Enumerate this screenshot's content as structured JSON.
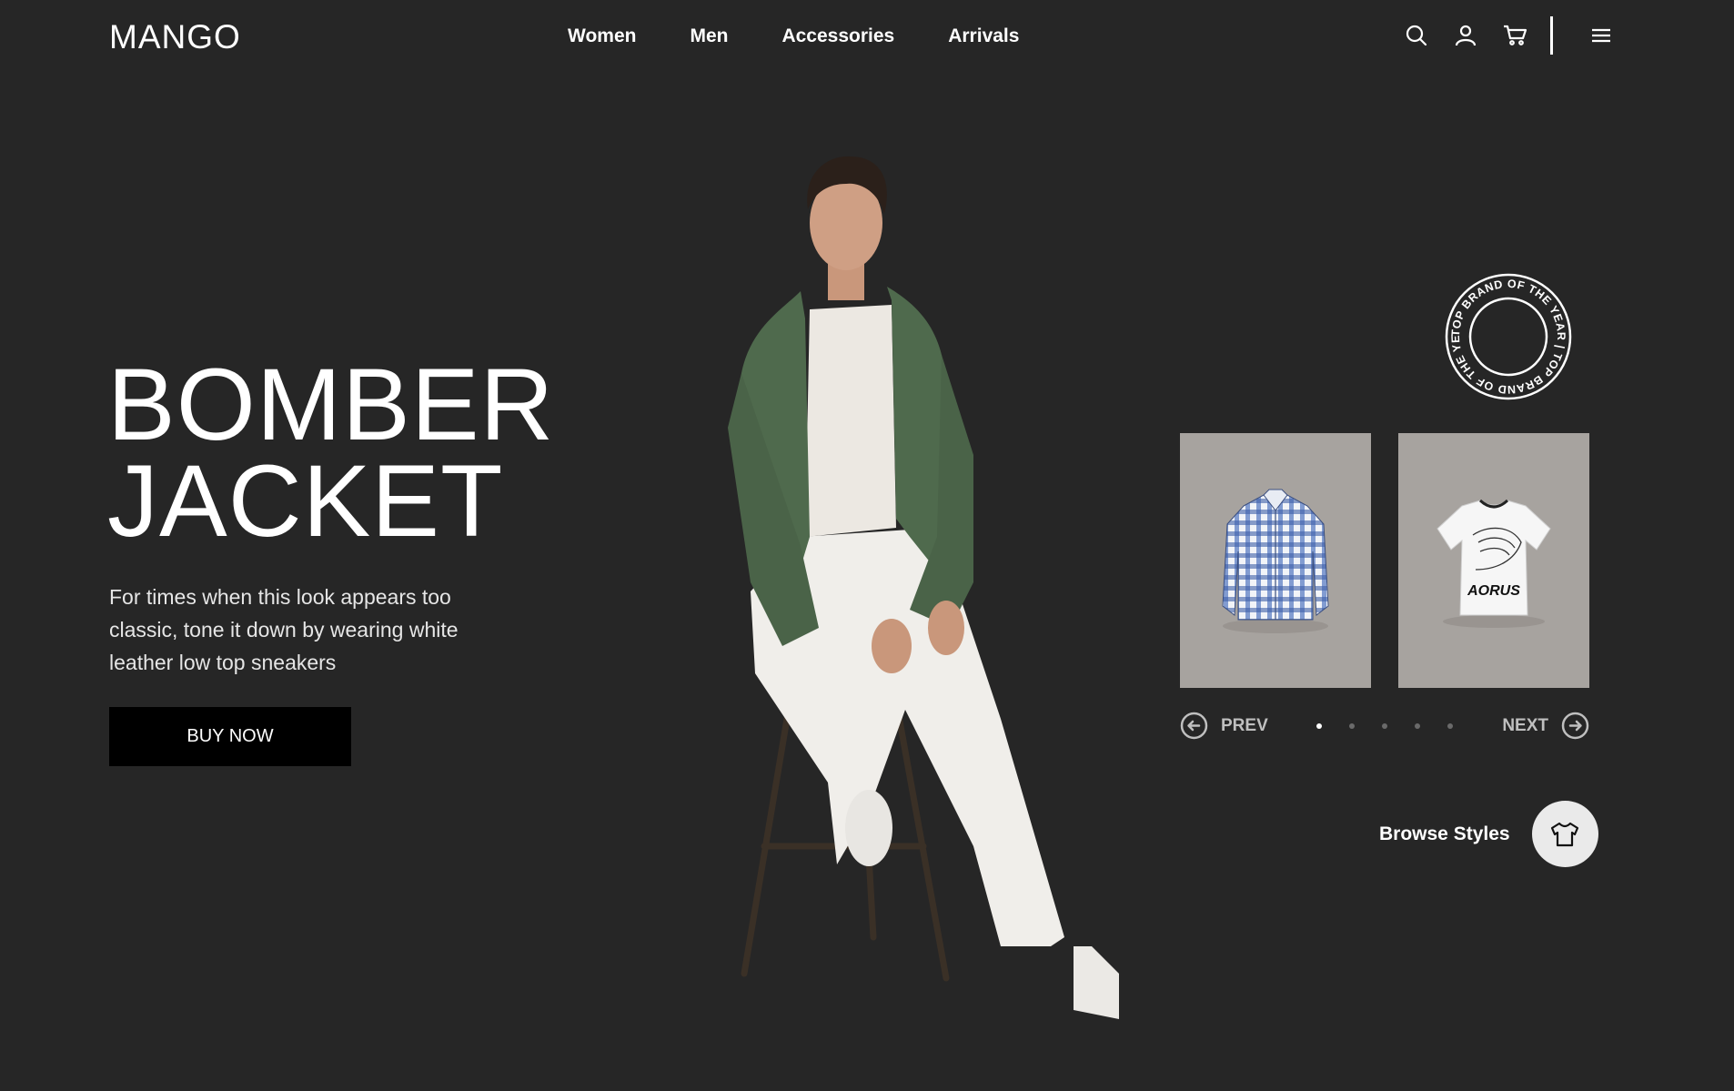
{
  "brand": {
    "logo": "MANGO"
  },
  "nav": {
    "items": [
      {
        "label": "Women"
      },
      {
        "label": "Men"
      },
      {
        "label": "Accessories"
      },
      {
        "label": "Arrivals"
      }
    ]
  },
  "header_icons": [
    "search-icon",
    "user-icon",
    "cart-icon",
    "menu-icon"
  ],
  "hero": {
    "title_line1": "BOMBER",
    "title_line2": "JACKET",
    "description": "For times when this look appears too classic, tone it down by wearing white leather low top sneakers",
    "cta": "BUY NOW"
  },
  "badge": {
    "text": "TOP BRAND OF THE YEAR | TOP BRAND OF THE YEAR |"
  },
  "products": [
    {
      "name": "plaid-shirt"
    },
    {
      "name": "graphic-tshirt",
      "print_text": "AORUS"
    }
  ],
  "pager": {
    "prev_label": "PREV",
    "next_label": "NEXT",
    "total": 5,
    "active": 1
  },
  "browse": {
    "label": "Browse Styles",
    "icon": "tshirt-icon"
  },
  "colors": {
    "background": "#262626",
    "button": "#000000",
    "card": "#a7a39f",
    "jacket": "#4f6a4d"
  }
}
